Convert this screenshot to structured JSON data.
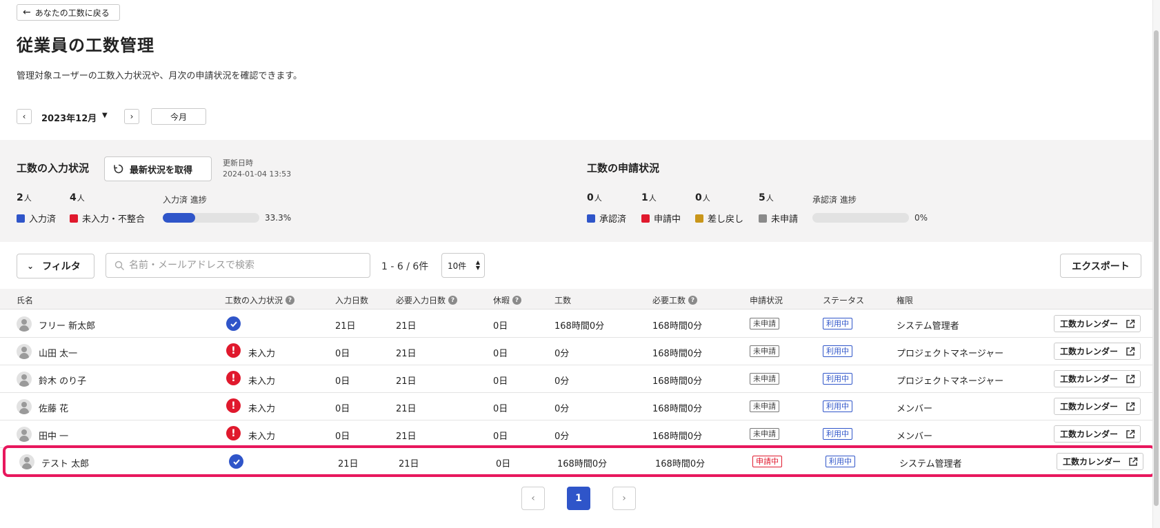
{
  "header": {
    "back_label": "あなたの工数に戻る",
    "title": "従業員の工数管理",
    "description": "管理対象ユーザーの工数入力状況や、月次の申請状況を確認できます。"
  },
  "month": {
    "label": "2023年12月",
    "today_label": "今月"
  },
  "input_status": {
    "title": "工数の入力状況",
    "refresh_label": "最新状況を取得",
    "updated_label": "更新日時",
    "updated_value": "2024-01-04 13:53",
    "unit": "人",
    "done_count": "2",
    "undone_count": "4",
    "done_label": "入力済",
    "undone_label": "未入力・不整合",
    "progress_label": "入力済 進捗",
    "progress_text": "33.3%",
    "progress_value": 0.333
  },
  "apply_status": {
    "title": "工数の申請状況",
    "unit": "人",
    "approved_count": "0",
    "applying_count": "1",
    "returned_count": "0",
    "unapplied_count": "5",
    "approved_label": "承認済",
    "applying_label": "申請中",
    "returned_label": "差し戻し",
    "unapplied_label": "未申請",
    "progress_label": "承認済 進捗",
    "progress_text": "0%",
    "progress_value": 0
  },
  "colors": {
    "blue": "#2f55c9",
    "red": "#e0192d",
    "gold": "#c9961a",
    "gray": "#8a8a8a",
    "highlight": "#e8175d"
  },
  "toolbar": {
    "filter_label": "フィルタ",
    "search_placeholder": "名前・メールアドレスで検索",
    "range_text": "1 - 6 / 6件",
    "per_page": "10件",
    "export_label": "エクスポート"
  },
  "table": {
    "headers": {
      "name": "氏名",
      "input_status": "工数の入力状況",
      "input_days": "入力日数",
      "required_days": "必要入力日数",
      "holidays": "休暇",
      "hours": "工数",
      "required_hours": "必要工数",
      "apply_status": "申請状況",
      "status": "ステータス",
      "role": "権限"
    },
    "help_icon": "?",
    "calendar_label": "工数カレンダー",
    "rows": [
      {
        "name": "フリー 新太郎",
        "input_ok": true,
        "input_text": "",
        "input_days": "21日",
        "required_days": "21日",
        "holidays": "0日",
        "hours": "168時間0分",
        "required_hours": "168時間0分",
        "apply_status": "未申請",
        "status": "利用中",
        "role": "システム管理者"
      },
      {
        "name": "山田 太一",
        "input_ok": false,
        "input_text": "未入力",
        "input_days": "0日",
        "required_days": "21日",
        "holidays": "0日",
        "hours": "0分",
        "required_hours": "168時間0分",
        "apply_status": "未申請",
        "status": "利用中",
        "role": "プロジェクトマネージャー"
      },
      {
        "name": "鈴木 のり子",
        "input_ok": false,
        "input_text": "未入力",
        "input_days": "0日",
        "required_days": "21日",
        "holidays": "0日",
        "hours": "0分",
        "required_hours": "168時間0分",
        "apply_status": "未申請",
        "status": "利用中",
        "role": "プロジェクトマネージャー"
      },
      {
        "name": "佐藤 花",
        "input_ok": false,
        "input_text": "未入力",
        "input_days": "0日",
        "required_days": "21日",
        "holidays": "0日",
        "hours": "0分",
        "required_hours": "168時間0分",
        "apply_status": "未申請",
        "status": "利用中",
        "role": "メンバー"
      },
      {
        "name": "田中 一",
        "input_ok": false,
        "input_text": "未入力",
        "input_days": "0日",
        "required_days": "21日",
        "holidays": "0日",
        "hours": "0分",
        "required_hours": "168時間0分",
        "apply_status": "未申請",
        "status": "利用中",
        "role": "メンバー"
      },
      {
        "name": "テスト 太郎",
        "input_ok": true,
        "input_text": "",
        "input_days": "21日",
        "required_days": "21日",
        "holidays": "0日",
        "hours": "168時間0分",
        "required_hours": "168時間0分",
        "apply_status": "申請中",
        "status": "利用中",
        "role": "システム管理者",
        "highlighted": true
      }
    ]
  },
  "pagination": {
    "current": "1"
  }
}
